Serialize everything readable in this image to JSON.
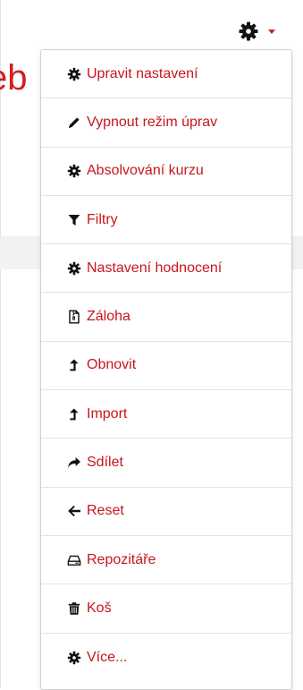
{
  "page": {
    "title_fragment": "eb"
  },
  "colors": {
    "accent": "#c8161d",
    "icon": "#111111"
  },
  "menu": {
    "items": [
      {
        "name": "menu-item-upravit-nastaveni",
        "icon": "gear-icon",
        "label": "Upravit nastavení"
      },
      {
        "name": "menu-item-vypnout-rezim-uprav",
        "icon": "pencil-icon",
        "label": "Vypnout režim úprav"
      },
      {
        "name": "menu-item-absolvovani-kurzu",
        "icon": "gear-icon",
        "label": "Absolvování kurzu"
      },
      {
        "name": "menu-item-filtry",
        "icon": "filter-icon",
        "label": "Filtry"
      },
      {
        "name": "menu-item-nastaveni-hodnoceni",
        "icon": "gear-icon",
        "label": "Nastavení hodnocení"
      },
      {
        "name": "menu-item-zaloha",
        "icon": "file-archive-icon",
        "label": "Záloha"
      },
      {
        "name": "menu-item-obnovit",
        "icon": "level-up-icon",
        "label": "Obnovit"
      },
      {
        "name": "menu-item-import",
        "icon": "level-up-icon",
        "label": "Import"
      },
      {
        "name": "menu-item-sdilet",
        "icon": "share-icon",
        "label": "Sdílet"
      },
      {
        "name": "menu-item-reset",
        "icon": "arrow-left-icon",
        "label": "Reset"
      },
      {
        "name": "menu-item-repozitare",
        "icon": "hdd-icon",
        "label": "Repozitáře"
      },
      {
        "name": "menu-item-kos",
        "icon": "trash-icon",
        "label": "Koš"
      },
      {
        "name": "menu-item-vice",
        "icon": "gear-icon",
        "label": "Více..."
      }
    ]
  }
}
